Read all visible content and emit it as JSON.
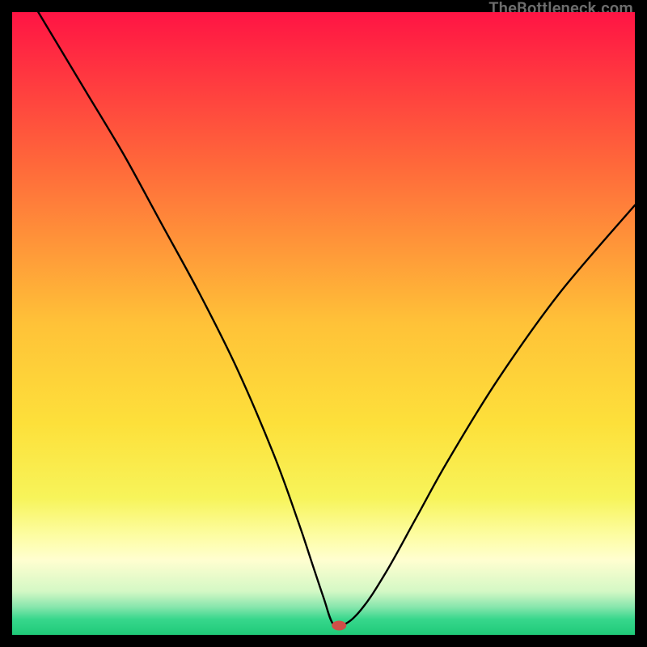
{
  "watermark": {
    "text": "TheBottleneck.com"
  },
  "chart_data": {
    "type": "line",
    "title": "",
    "xlabel": "",
    "ylabel": "",
    "xlim": [
      0,
      100
    ],
    "ylim": [
      0,
      100
    ],
    "grid": false,
    "legend": false,
    "background_gradient": {
      "stops": [
        {
          "offset": 0.0,
          "color": "#ff1444"
        },
        {
          "offset": 0.25,
          "color": "#ff6a3a"
        },
        {
          "offset": 0.5,
          "color": "#ffc238"
        },
        {
          "offset": 0.66,
          "color": "#fde03a"
        },
        {
          "offset": 0.78,
          "color": "#f7f45a"
        },
        {
          "offset": 0.84,
          "color": "#fdfda2"
        },
        {
          "offset": 0.88,
          "color": "#fffed0"
        },
        {
          "offset": 0.93,
          "color": "#d4f8c5"
        },
        {
          "offset": 0.955,
          "color": "#88e6ad"
        },
        {
          "offset": 0.975,
          "color": "#37d78c"
        },
        {
          "offset": 1.0,
          "color": "#1fca79"
        }
      ]
    },
    "series": [
      {
        "name": "bottleneck-curve",
        "color": "#000000",
        "x": [
          0,
          6,
          12,
          18,
          24,
          30,
          36,
          42,
          46,
          48,
          50,
          51.5,
          53,
          56,
          60,
          65,
          70,
          78,
          88,
          100
        ],
        "y": [
          107,
          97,
          87,
          77,
          66,
          55,
          43,
          29,
          18,
          12,
          6,
          1.8,
          1.5,
          4,
          10,
          19,
          28,
          41,
          55,
          69
        ],
        "flat_min_range_x": [
          50.5,
          53.5
        ],
        "smoothing": "s-curve-intermediate"
      }
    ],
    "marker": {
      "name": "min-point",
      "x": 52.5,
      "y": 1.5,
      "rx": 9,
      "ry": 6,
      "color": "#cf4f48"
    }
  }
}
